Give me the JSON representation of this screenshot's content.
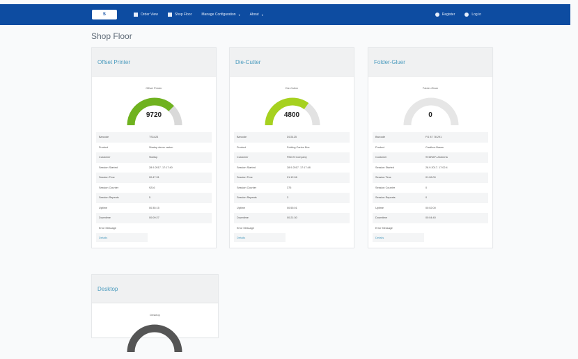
{
  "header": {
    "logo": "S",
    "nav": [
      {
        "label": "Order  View"
      },
      {
        "label": "Shop  Floor"
      },
      {
        "label": "Manage Configuration"
      },
      {
        "label": "About"
      }
    ],
    "right": [
      {
        "label": "Register"
      },
      {
        "label": "Log in"
      }
    ]
  },
  "page": {
    "title": "Shop Floor"
  },
  "machines": [
    {
      "name": "Offset Printer",
      "gauge_title": "Offset Printer",
      "value": "9720",
      "fill": 0.75,
      "colors": {
        "fill": "#6fb21f",
        "track": "#d9d9d9"
      },
      "rows": [
        {
          "label": "Barcode",
          "value": "TS1423"
        },
        {
          "label": "Product",
          "value": "Startup demo carton"
        },
        {
          "label": "Customer",
          "value": "Startup"
        },
        {
          "label": "Session Started",
          "value": "28.9.2017. 17:17:40"
        },
        {
          "label": "Session Time",
          "value": "00:47:31"
        },
        {
          "label": "Session Counter",
          "value": "9216"
        },
        {
          "label": "Session Repeats",
          "value": "5"
        },
        {
          "label": "Uptime",
          "value": "00:35:15"
        },
        {
          "label": "Downtime",
          "value": "00:09:27"
        },
        {
          "label": "Error Message",
          "value": ""
        }
      ],
      "details": "Details"
    },
    {
      "name": "Die-Cutter",
      "gauge_title": "Die-Cutter",
      "value": "4800",
      "fill": 0.7,
      "colors": {
        "fill": "#a6d11f",
        "track": "#e2e2e2"
      },
      "rows": [
        {
          "label": "Barcode",
          "value": "DC5125"
        },
        {
          "label": "Product",
          "value": "Folding Carton Box"
        },
        {
          "label": "Customer",
          "value": "FINCS Company"
        },
        {
          "label": "Session Started",
          "value": "28.9.2017. 17:17:48"
        },
        {
          "label": "Session Time",
          "value": "01:12:06"
        },
        {
          "label": "Session Counter",
          "value": "375"
        },
        {
          "label": "Session Repeats",
          "value": "3"
        },
        {
          "label": "Uptime",
          "value": "00:55:01"
        },
        {
          "label": "Downtime",
          "value": "00:21:30"
        },
        {
          "label": "Error Message",
          "value": ""
        }
      ],
      "details": "Details"
    },
    {
      "name": "Folder-Gluer",
      "gauge_title": "Folder-Gluer",
      "value": "0",
      "fill": 0,
      "colors": {
        "fill": "#cccccc",
        "track": "#e6e6e6"
      },
      "rows": [
        {
          "label": "Barcode",
          "value": "FG 87 78 291"
        },
        {
          "label": "Product",
          "value": "Cardbox Bases"
        },
        {
          "label": "Customer",
          "value": "STARAP-Uboberta"
        },
        {
          "label": "Session Started",
          "value": "28.9.2017. 17:02:4"
        },
        {
          "label": "Session Time",
          "value": "01:06:00"
        },
        {
          "label": "Session Counter",
          "value": "0"
        },
        {
          "label": "Session Repeats",
          "value": "0"
        },
        {
          "label": "Uptime",
          "value": "00:02:00"
        },
        {
          "label": "Downtime",
          "value": "00:04:40"
        },
        {
          "label": "Error Message",
          "value": ""
        }
      ],
      "details": "Details"
    },
    {
      "name": "Desktop",
      "gauge_title": "Desktop",
      "value": "",
      "fill": 0,
      "colors": {
        "fill": "#555555",
        "track": "#555555"
      },
      "rows": [],
      "details": ""
    }
  ]
}
